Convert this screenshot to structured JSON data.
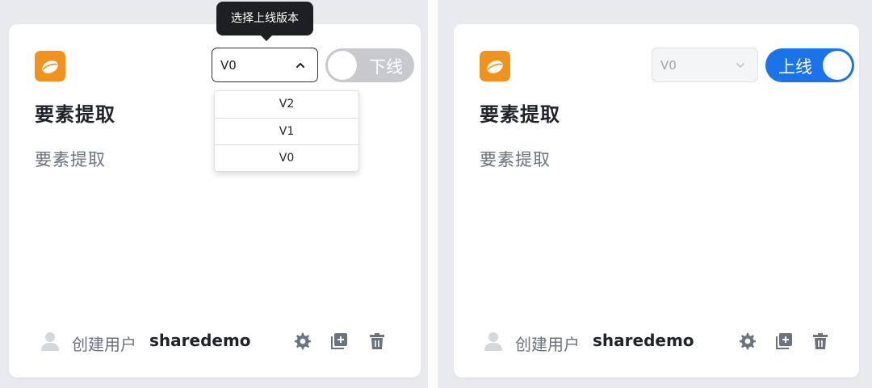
{
  "cards": [
    {
      "title": "要素提取",
      "description": "要素提取",
      "version_select": {
        "value": "V0",
        "open": true
      },
      "tooltip": "选择上线版本",
      "dropdown_options": [
        "V2",
        "V1",
        "V0"
      ],
      "toggle": {
        "label": "下线",
        "on": false
      },
      "creator_label": "创建用户",
      "creator_name": "sharedemo"
    },
    {
      "title": "要素提取",
      "description": "要素提取",
      "version_select": {
        "value": "V0",
        "open": false,
        "disabled": true
      },
      "toggle": {
        "label": "上线",
        "on": true
      },
      "creator_label": "创建用户",
      "creator_name": "sharedemo"
    }
  ],
  "colors": {
    "app_icon": "#f0931e",
    "toggle_on": "#1a73e8",
    "toggle_off": "#c7c9ce",
    "action_icon": "#6b7280"
  },
  "icons": [
    "app-egg-icon",
    "user-icon",
    "gear-icon",
    "copy-add-icon",
    "trash-icon",
    "chevron-up-icon",
    "chevron-down-icon"
  ]
}
